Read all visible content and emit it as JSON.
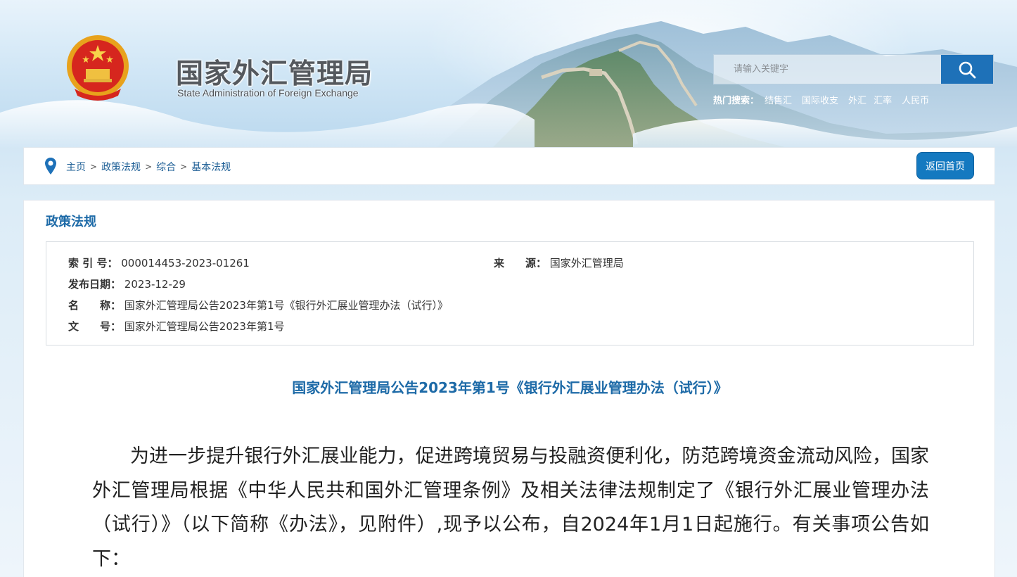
{
  "header": {
    "title_cn": "国家外汇管理局",
    "title_en": "State Administration of Foreign Exchange",
    "emblem_icon": "national-emblem-icon"
  },
  "search": {
    "placeholder": "请输入关键字",
    "button_icon": "search-icon",
    "hot_label": "热门搜索：",
    "hot_items": [
      "结售汇",
      "国际收支",
      "外汇",
      "汇率",
      "人民币"
    ]
  },
  "breadcrumb": {
    "items": [
      "主页",
      "政策法规",
      "综合",
      "基本法规"
    ],
    "separator": ">",
    "home_button": "返回首页"
  },
  "main": {
    "section_title": "政策法规",
    "meta": {
      "index_label": "索 引 号：",
      "index_value": "000014453-2023-01261",
      "source_label": "来　　源：",
      "source_value": "国家外汇管理局",
      "date_label": "发布日期：",
      "date_value": "2023-12-29",
      "name_label": "名　　称：",
      "name_value": "国家外汇管理局公告2023年第1号《银行外汇展业管理办法（试行）》",
      "docno_label": "文　　号：",
      "docno_value": "国家外汇管理局公告2023年第1号"
    },
    "doc_title": "国家外汇管理局公告2023年第1号《银行外汇展业管理办法（试行）》",
    "doc_body": "为进一步提升银行外汇展业能力，促进跨境贸易与投融资便利化，防范跨境资金流动风险，国家外汇管理局根据《中华人民共和国外汇管理条例》及相关法律法规制定了《银行外汇展业管理办法（试行）》（以下简称《办法》，见附件）,现予以公布，自2024年1月1日起施行。有关事项公告如下："
  },
  "colors": {
    "accent": "#1d6aa7",
    "button": "#1479c0",
    "search_button": "#1e71b8"
  }
}
